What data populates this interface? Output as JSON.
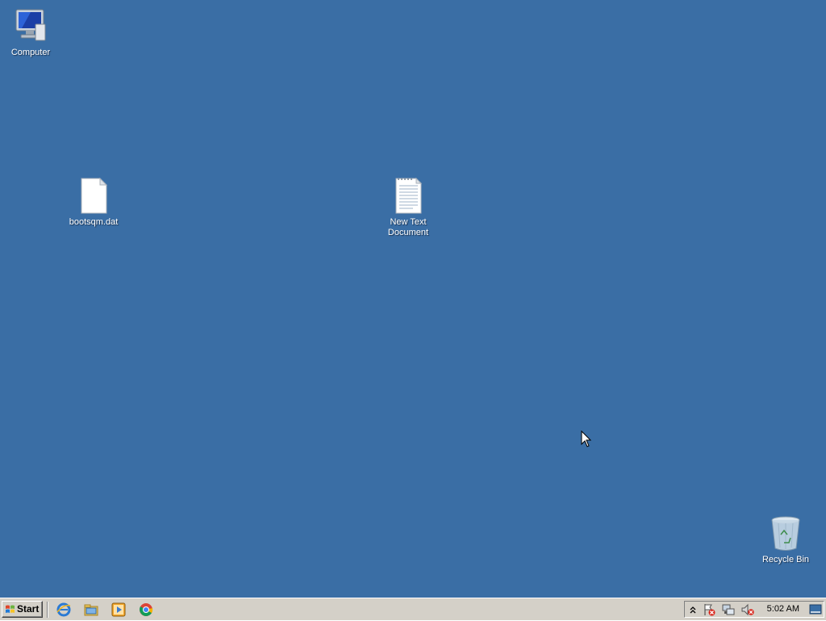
{
  "desktop": {
    "background_color": "#3a6ea5",
    "icons": [
      {
        "label": "Computer",
        "icon": "computer-icon"
      },
      {
        "label": "bootsqm.dat",
        "icon": "blank-file-icon"
      },
      {
        "label": "New Text\nDocument",
        "icon": "text-document-icon"
      },
      {
        "label": "Recycle Bin",
        "icon": "recycle-bin-icon"
      }
    ]
  },
  "taskbar": {
    "start_label": "Start",
    "quick_launch": [
      {
        "icon": "internet-explorer-icon"
      },
      {
        "icon": "windows-explorer-icon"
      },
      {
        "icon": "media-player-icon"
      },
      {
        "icon": "chrome-icon"
      }
    ],
    "tray": {
      "icons": [
        "show-hidden-icons-icon",
        "action-center-icon",
        "network-icon",
        "volume-muted-icon"
      ],
      "clock": "5:02 AM",
      "show_desktop": "show-desktop-icon"
    }
  }
}
